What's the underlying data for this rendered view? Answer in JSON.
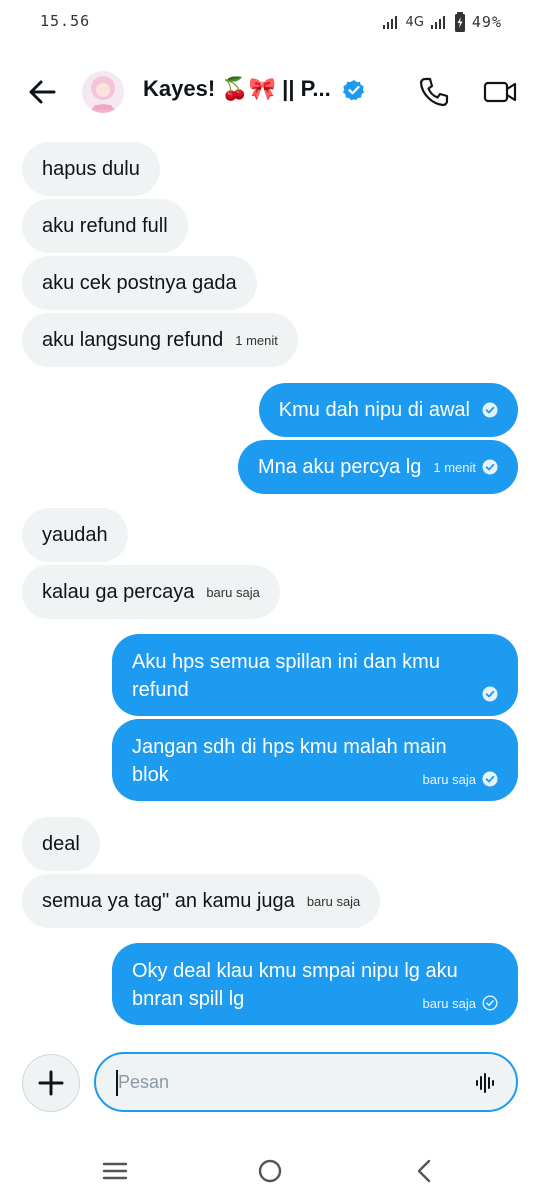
{
  "status_bar": {
    "time": "15.56",
    "network": "4G",
    "battery": "49%"
  },
  "header": {
    "title": "Kayes! 🍒🎀 || P..."
  },
  "messages": [
    {
      "text": "hapus dulu"
    },
    {
      "text": "aku refund full"
    },
    {
      "text": "aku cek postnya gada"
    },
    {
      "text": "aku langsung refund",
      "time": "1 menit"
    },
    {
      "text": "Kmu dah nipu di awal"
    },
    {
      "text": "Mna aku percya lg",
      "time": "1 menit"
    },
    {
      "text": "yaudah"
    },
    {
      "text": "kalau ga percaya",
      "time": "baru saja"
    },
    {
      "line1": "Aku hps semua spillan ini dan kmu",
      "line2": "refund"
    },
    {
      "line1": "Jangan sdh di hps kmu malah main",
      "line2": "blok",
      "time": "baru saja"
    },
    {
      "text": "deal"
    },
    {
      "text": "semua ya tag\" an kamu juga",
      "time": "baru saja"
    },
    {
      "line1": "Oky deal klau kmu smpai nipu lg aku",
      "line2": "bnran spill lg",
      "time": "baru saja"
    }
  ],
  "composer": {
    "placeholder": "Pesan"
  },
  "colors": {
    "accent": "#1d9bf0",
    "incoming_bg": "#eff3f4"
  }
}
